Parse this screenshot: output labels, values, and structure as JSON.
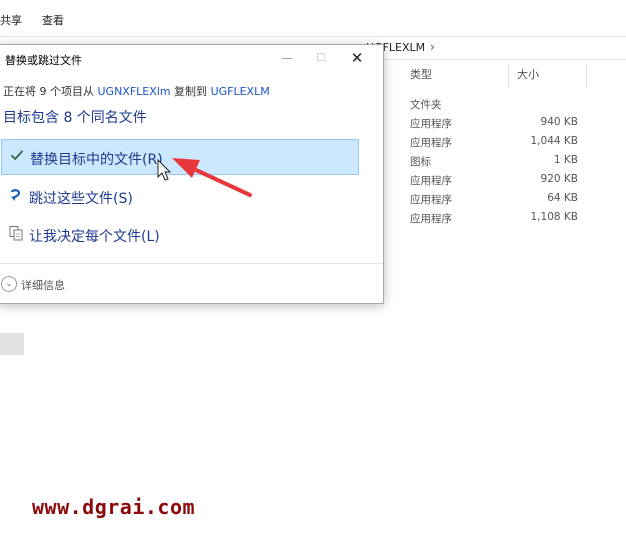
{
  "ribbon": {
    "tabs": [
      {
        "label": "共享"
      },
      {
        "label": "查看"
      }
    ]
  },
  "address_bar": {
    "current_folder": "UGFLEXLM",
    "chevron": "›"
  },
  "file_list": {
    "columns": {
      "type": "类型",
      "size": "大小"
    },
    "rows": [
      {
        "type": "文件夹",
        "size": ""
      },
      {
        "type": "应用程序",
        "size": "940 KB"
      },
      {
        "type": "应用程序",
        "size": "1,044 KB"
      },
      {
        "type": "图标",
        "size": "1 KB"
      },
      {
        "type": "应用程序",
        "size": "920 KB"
      },
      {
        "type": "应用程序",
        "size": "64 KB"
      },
      {
        "type": "应用程序",
        "size": "1,108 KB"
      }
    ]
  },
  "dialog": {
    "title": "替换或跳过文件",
    "copy_prefix": "正在将 9 个项目从 ",
    "source": "UGNXFLEXlm",
    "copy_middle": " 复制到 ",
    "destination": "UGFLEXLM",
    "heading": "目标包含 8 个同名文件",
    "options": [
      {
        "label": "替换目标中的文件(R)",
        "icon": "check-icon",
        "selected": true
      },
      {
        "label": "跳过这些文件(S)",
        "icon": "skip-arrow-icon",
        "selected": false
      },
      {
        "label": "让我决定每个文件(L)",
        "icon": "compare-files-icon",
        "selected": false
      }
    ],
    "details_label": "详细信息"
  },
  "watermark": "www.dgrai.com",
  "colors": {
    "selection_bg": "#cce8ff",
    "selection_border": "#99c9ef",
    "link": "#1a55c8",
    "heading": "#1d3a8f",
    "arrow": "#e8383d",
    "watermark": "#8b0a0a"
  }
}
